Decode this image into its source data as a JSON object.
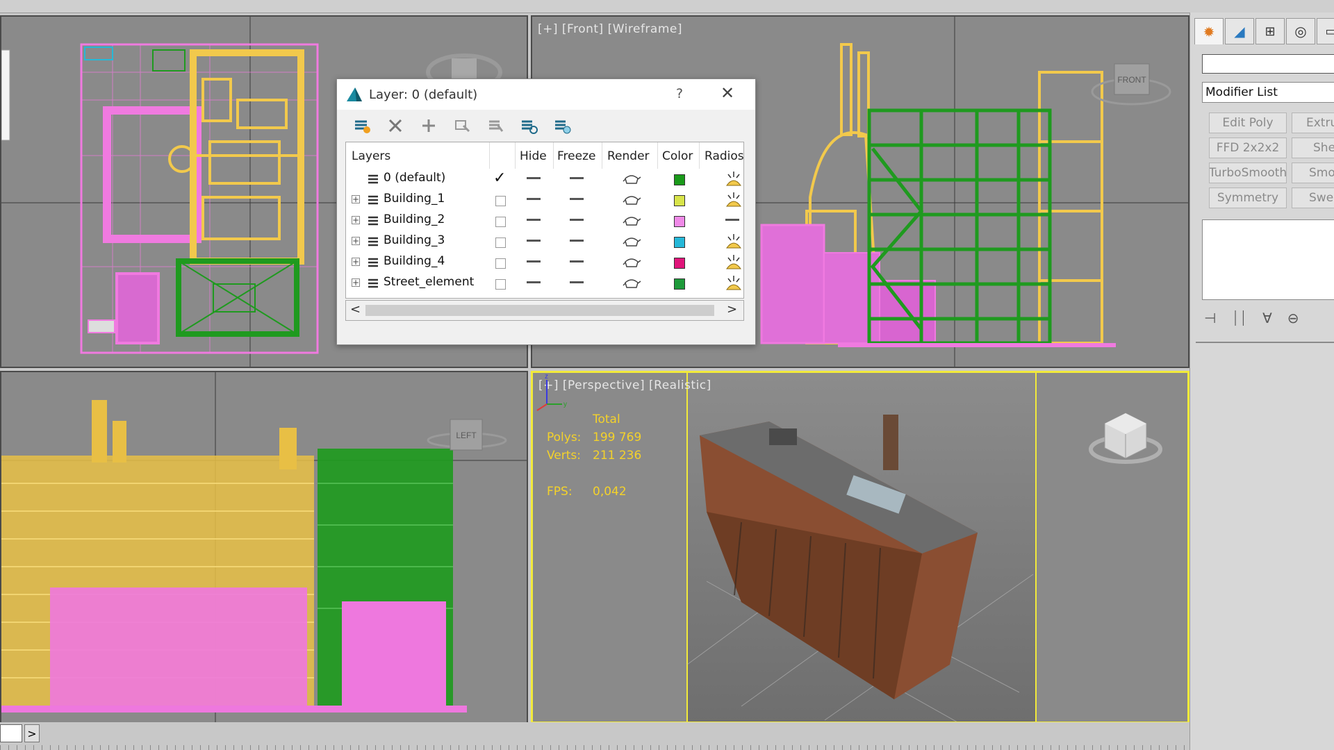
{
  "viewports": {
    "front": {
      "label": "[+] [Front] [Wireframe]",
      "cube_label": "FRONT"
    },
    "left": {
      "cube_label": "LEFT"
    },
    "perspective": {
      "label": "[+] [Perspective] [Realistic]",
      "stats": {
        "header": "Total",
        "polys_label": "Polys:",
        "polys": "199 769",
        "verts_label": "Verts:",
        "verts": "211 236",
        "fps_label": "FPS:",
        "fps": "0,042"
      }
    }
  },
  "dialog": {
    "title": "Layer: 0 (default)",
    "help": "?",
    "close": "✕",
    "columns": [
      "Layers",
      "Hide",
      "Freeze",
      "Render",
      "Color",
      "Radiosi"
    ],
    "layers": [
      {
        "name": "0 (default)",
        "color": "#1a9a1a",
        "current": true
      },
      {
        "name": "Building_1",
        "color": "#d8e44a"
      },
      {
        "name": "Building_2",
        "color": "#f08ae8"
      },
      {
        "name": "Building_3",
        "color": "#26b8d8"
      },
      {
        "name": "Building_4",
        "color": "#e0157a"
      },
      {
        "name": "Street_element",
        "color": "#1e9a3a"
      }
    ],
    "scroll_left": "<",
    "scroll_right": ">"
  },
  "command_panel": {
    "modifier_list": "Modifier List",
    "buttons": [
      "Edit Poly",
      "Extru",
      "FFD 2x2x2",
      "She",
      "TurboSmooth",
      "Smo",
      "Symmetry",
      "Swe"
    ]
  },
  "timeline": {
    "next": ">"
  },
  "colors": {
    "wire_yellow": "#f2c94c",
    "wire_pink": "#f07ae0",
    "wire_green": "#1f9a1f",
    "active_border": "#f2ea3a",
    "stats_text": "#f4d22a"
  }
}
